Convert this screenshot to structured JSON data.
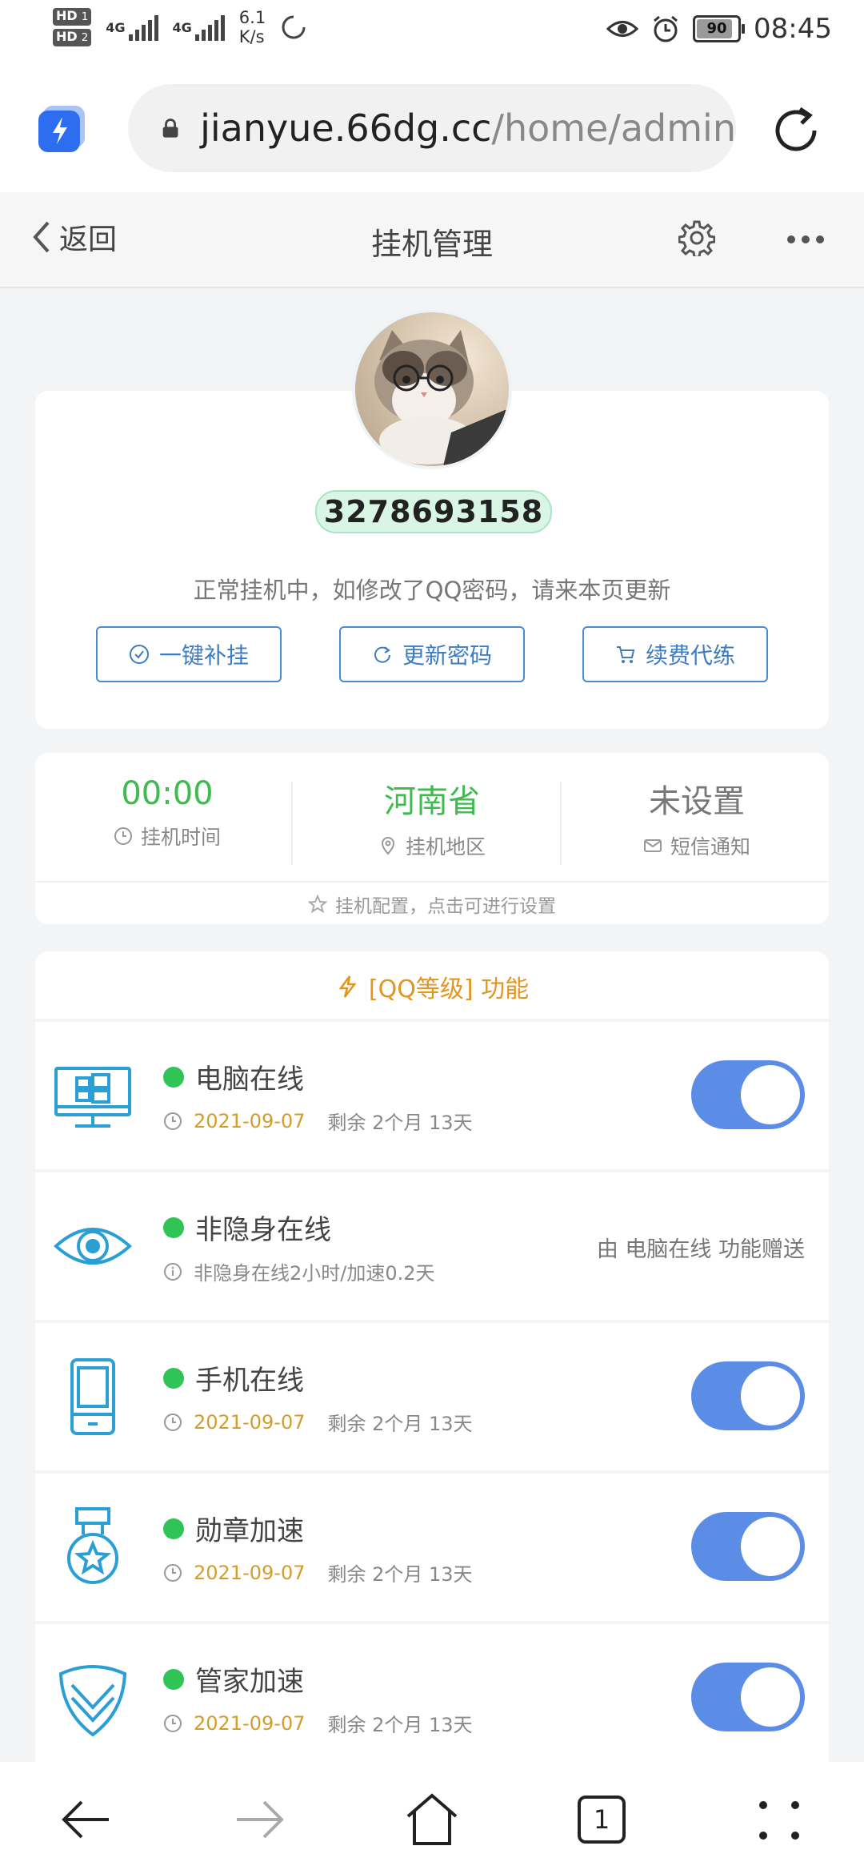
{
  "status_bar": {
    "hd1": "HD",
    "hd1_sub": "1",
    "hd2": "HD",
    "hd2_sub": "2",
    "net1": "4G",
    "net2": "4G",
    "speed_value": "6.1",
    "speed_unit": "K/s",
    "battery": "90",
    "time": "08:45"
  },
  "browser": {
    "url_domain": "jianyue.66dg.cc",
    "url_path": "/home/admin"
  },
  "nav": {
    "back_label": "返回",
    "title": "挂机管理"
  },
  "profile": {
    "qq_number": "3278693158",
    "notice": "正常挂机中，如修改了QQ密码，请来本页更新",
    "buttons": [
      {
        "label": "一键补挂",
        "icon": "check-circle-icon"
      },
      {
        "label": "更新密码",
        "icon": "refresh-icon"
      },
      {
        "label": "续费代练",
        "icon": "cart-icon"
      }
    ]
  },
  "stats": {
    "items": [
      {
        "value": "00:00",
        "label": "挂机时间",
        "icon": "clock-icon"
      },
      {
        "value": "河南省",
        "label": "挂机地区",
        "icon": "location-icon"
      },
      {
        "value": "未设置",
        "label": "短信通知",
        "icon": "mail-icon"
      }
    ],
    "config_hint": "挂机配置，点击可进行设置"
  },
  "features": {
    "header": "[QQ等级] 功能",
    "items": [
      {
        "name": "电脑在线",
        "date": "2021-09-07",
        "remaining": "剩余 2个月 13天",
        "icon": "computer-icon",
        "toggle_on": true
      },
      {
        "name": "非隐身在线",
        "info": "非隐身在线2小时/加速0.2天",
        "gift": "由 电脑在线 功能赠送",
        "icon": "eye-icon"
      },
      {
        "name": "手机在线",
        "date": "2021-09-07",
        "remaining": "剩余 2个月 13天",
        "icon": "phone-icon",
        "toggle_on": true
      },
      {
        "name": "勋章加速",
        "date": "2021-09-07",
        "remaining": "剩余 2个月 13天",
        "icon": "medal-icon",
        "toggle_on": true
      },
      {
        "name": "管家加速",
        "date": "2021-09-07",
        "remaining": "剩余 2个月 13天",
        "icon": "shield-icon",
        "toggle_on": true
      }
    ]
  },
  "bottom_bar": {
    "tab_count": "1"
  },
  "colors": {
    "accent_blue": "#4a8bd1",
    "toggle_blue": "#5b8de6",
    "green": "#3dbb4f",
    "orange": "#e2961d"
  }
}
